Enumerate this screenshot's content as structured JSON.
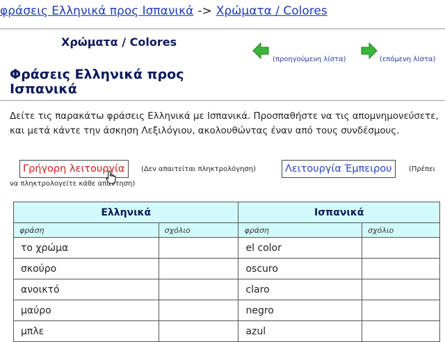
{
  "breadcrumb": {
    "link1": "φράσεις Ελληνικά προς Ισπανικά",
    "separator": "->",
    "link2": "Χρώματα / Colores"
  },
  "list_title": "Χρώματα / Colores",
  "nav": {
    "prev_label": "(προηγούμενη λίστα)",
    "next_label": "(επόμενη λίστα)"
  },
  "section_title": "Φράσεις Ελληνικά προς Ισπανικά",
  "intro_text": "Δείτε τις παρακάτω φράσεις Ελληνικά με Ισπανικά. Προσπαθήστε να τις απομνημονεύσετε, και μετά κάντε την άσκηση Λεξιλόγιου, ακολουθώντας έναν από τους συνδέσμους.",
  "modes": {
    "quick_label": "Γρήγορη λειτουργία",
    "quick_note": "(Δεν απαιτείται πληκτρολόγηση)",
    "expert_label": "Λειτουργία Έμπειρου",
    "expert_note_1": "(Πρέπει",
    "expert_note_2": "να πληκτρολογείτε κάθε απάντηση)"
  },
  "table": {
    "lang_left": "Ελληνικά",
    "lang_right": "Ισπανικά",
    "col_phrase": "φράση",
    "col_comment": "σχόλιο",
    "rows": [
      {
        "greek": "το χρώμα",
        "spanish": "el color"
      },
      {
        "greek": "σκούρο",
        "spanish": "oscuro"
      },
      {
        "greek": "ανοικτό",
        "spanish": "claro"
      },
      {
        "greek": "μαύρο",
        "spanish": "negro"
      },
      {
        "greek": "μπλε",
        "spanish": "azul"
      }
    ]
  },
  "colors": {
    "link": "#1e3cb4",
    "heading": "#0e1a5c",
    "quick_mode": "#d41b1b",
    "expert_mode": "#2447c4",
    "table_header_bg": "#d2fafa",
    "arrow_green": "#3bb83b"
  },
  "icons": {
    "prev": "green-left-arrow-icon",
    "next": "green-right-arrow-icon",
    "cursor": "hand-pointer-icon"
  }
}
